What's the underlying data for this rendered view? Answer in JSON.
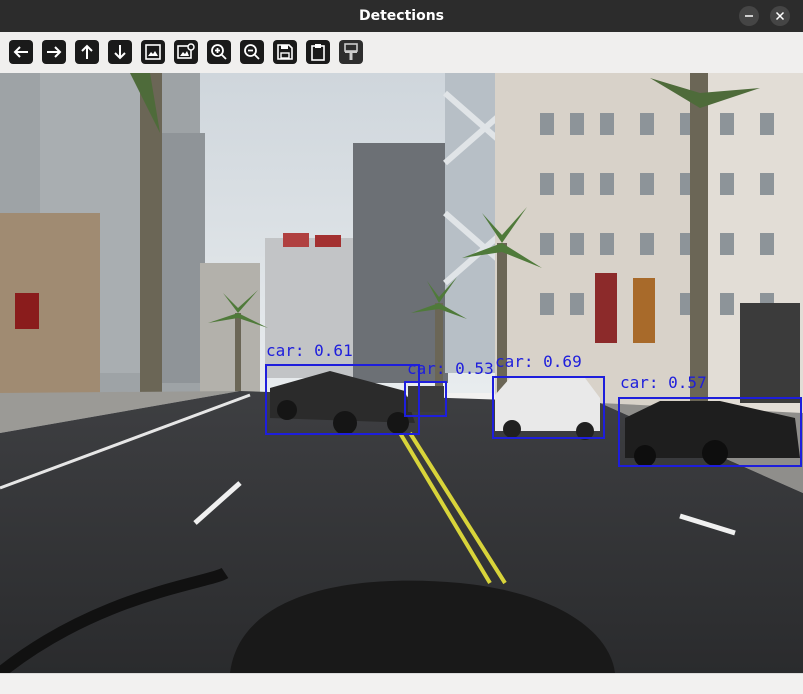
{
  "window": {
    "title": "Detections"
  },
  "toolbar": {
    "tools": [
      {
        "icon": "arrow-left-icon"
      },
      {
        "icon": "arrow-right-icon"
      },
      {
        "icon": "arrow-up-icon"
      },
      {
        "icon": "arrow-down-icon"
      },
      {
        "icon": "image-icon"
      },
      {
        "icon": "image-settings-icon"
      },
      {
        "icon": "zoom-in-icon"
      },
      {
        "icon": "zoom-out-icon"
      },
      {
        "icon": "save-icon"
      },
      {
        "icon": "clipboard-icon"
      },
      {
        "icon": "paint-brush-icon"
      }
    ]
  },
  "detections": [
    {
      "label": "car: 0.61"
    },
    {
      "label": "car: 0.53"
    },
    {
      "label": "car: 0.69"
    },
    {
      "label": "car: 0.57"
    }
  ],
  "colors": {
    "box": "#1e1edc",
    "titlebar": "#2c2c2c"
  }
}
